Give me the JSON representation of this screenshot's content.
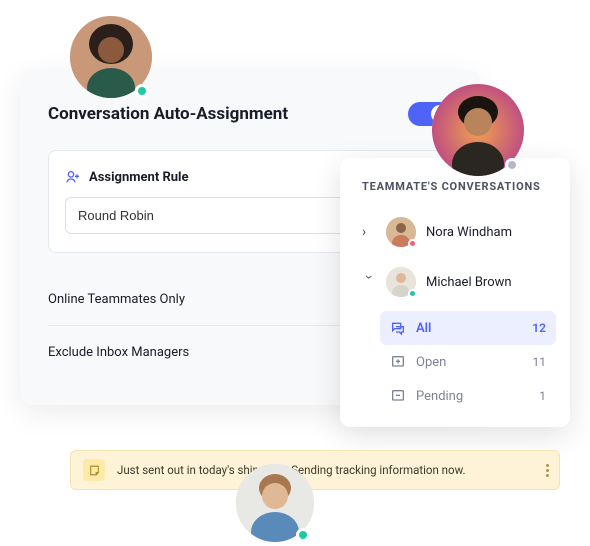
{
  "card": {
    "title": "Conversation Auto-Assignment",
    "rule_label": "Assignment Rule",
    "rule_value": "Round Robin",
    "options": [
      {
        "label": "Online Teammates Only"
      },
      {
        "label": "Exclude Inbox Managers"
      }
    ]
  },
  "panel": {
    "title": "TEAMMATE'S CONVERSATIONS",
    "teammates": [
      {
        "name": "Nora Windham",
        "expanded": false,
        "status_color": "#f25f7a"
      },
      {
        "name": "Michael Brown",
        "expanded": true,
        "status_color": "#1ec9a4"
      }
    ],
    "conversations": [
      {
        "label": "All",
        "count": "12",
        "active": true
      },
      {
        "label": "Open",
        "count": "11",
        "active": false
      },
      {
        "label": "Pending",
        "count": "1",
        "active": false
      }
    ]
  },
  "notification": {
    "text": "Just sent out in today's shipment. Sending tracking information now."
  },
  "colors": {
    "primary": "#4f63f7",
    "online": "#1ec9a4",
    "away": "#b4b8c5",
    "busy": "#f25f7a"
  }
}
